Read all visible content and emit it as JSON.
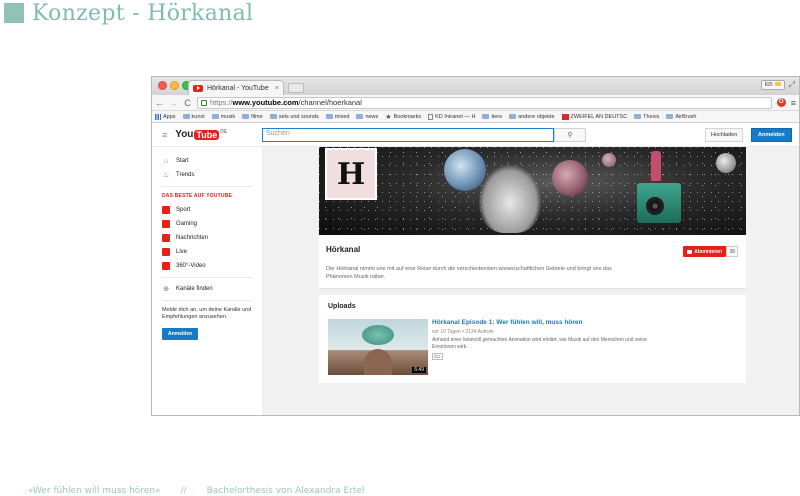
{
  "slide": {
    "title": "Konzept - Hörkanal",
    "footer_left": "»Wer fühlen will muss hören«",
    "footer_sep": "//",
    "footer_right": "Bachelorthesis von Alexandra Ertel"
  },
  "browser": {
    "tab_title": "Hörkanal - YouTube",
    "tab_close": "×",
    "user_label": "Ich",
    "expand_glyph": "⤢",
    "url_protocol": "https://",
    "url_host": "www.youtube.com",
    "url_path": "/channel/hoerkanal",
    "extension_glyph": "O",
    "bookmarks": [
      "Apps",
      "kunst",
      "musik",
      "filme",
      "sets und sounds",
      "mixed",
      "news",
      "Bookmarks",
      "KD Intranet — H",
      "tiere",
      "andere objekte",
      "ZWEIFEL AN DEUTSC",
      "Thesis",
      "AirBrush"
    ]
  },
  "youtube": {
    "logo_you": "You",
    "logo_tube": "Tube",
    "logo_cc": "DE",
    "search_placeholder": "Suchen",
    "search_glyph": "⚲",
    "upload_label": "Hochladen",
    "login_label": "Anmelden",
    "sidebar": {
      "start": "Start",
      "trends": "Trends",
      "section_heading": "DAS BESTE AUF YOUTUBE",
      "categories": [
        "Sport",
        "Gaming",
        "Nachrichten",
        "Live",
        "360°-Video"
      ],
      "find_channels": "Kanäle finden",
      "login_note": "Melde dich an, um deine Kanäle und Empfehlungen anzusehen.",
      "login_button": "Anmelden"
    },
    "channel": {
      "avatar_letter": "H",
      "name": "Hörkanal",
      "subscribe_label": "Abonnieren",
      "subscriber_count": "38",
      "description": "Der Hörkanal nimmt une mit auf eine Reise durch die verschiedensten wissenschaftlichen Gebiete und bringt uns das Phänomen Musik näher."
    },
    "uploads": {
      "heading": "Uploads",
      "video_title": "Hörkanal Episode 1: Wer fühlen will, muss hören",
      "video_meta": "vor 10 Tagen  •  2134 Aufrufe",
      "video_desc": "Anhand einer liebevoll gemachten Animation wird erklärt, wie Musik auf den Menschen und seine Emotionen wirk.",
      "duration": "6:49",
      "cc": "CC"
    }
  },
  "colors": {
    "slide_accent": "#7fbcb0",
    "youtube_red": "#e62117",
    "youtube_blue": "#167ac6"
  }
}
